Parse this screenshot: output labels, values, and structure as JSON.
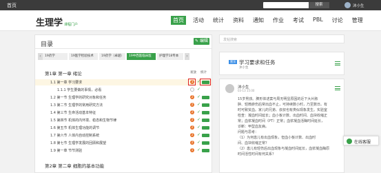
{
  "topbar": {
    "home": "首页",
    "search_button": "搜索",
    "user": "沐小生"
  },
  "header": {
    "logo": "生理学",
    "logo_sub": "课程门户"
  },
  "nav": [
    "首页",
    "活动",
    "统计",
    "资料",
    "通知",
    "作业",
    "考试",
    "PBL",
    "讨论",
    "管理"
  ],
  "catalog": {
    "title": "目录",
    "edit_label": "编辑",
    "tabs": [
      "19药学",
      "19医学检验技术",
      "19药学（卓越）",
      "19中西医临床医",
      "护理学18专本"
    ],
    "col_release": "发放",
    "col_stats": "统计",
    "chapter1": "第1章 第一章 绪论",
    "rows": [
      "1.1 第一章 学习要求",
      "1.1.1 学生要做的事情，必看",
      "1.2 第一节 生理学的研究对象和任务",
      "1.3 第二节 生理学的常用研究方法",
      "1.4 第三节 生命活动基本特征",
      "1.5 第四节 机体的内环境、稳态和生物节律",
      "1.6 第五节 机体生理功能的调节",
      "1.7 第六节 人体内自动控制系统",
      "1.8 第七节 生理学发展的回顾和展望",
      "1.9 第一章 节节测验"
    ],
    "chapter2": "第2章 第二章 细胞的基本功能"
  },
  "right": {
    "search_placeholder": "发帖搜索",
    "tag": "置顶",
    "card_title": "学习要求和任务",
    "card_author": "沐小生",
    "post_name": "沐小生",
    "post_date": "03-13 15:00",
    "post_lines": [
      "15岁男孩。脾形体述案与周无明显原因的近下大片脓",
      "肿、轻微瘀伤后常出血不止，可持续数小时，乃至数日。有",
      "时可致贫血。家儿的兄弟、叔叔也有类似现象发生。实验室",
      "检查：凝血时间延长；血小板计数、出血时间、血块收缩正",
      "常；血浆凝血时间（PT）正常；血浆凝血活酶时间延长，",
      "诊断：甲型血友病。",
      "问题与思考：",
      "（1）为何患儿有出血现象，但血小板计数、出血时",
      "间、血块收缩正常？",
      "（2）患儿有轻伤后出血现象与凝血时间延长，血浆凝血酶原",
      "时间活性时间有何关系？"
    ]
  },
  "help_label": "在线客服"
}
